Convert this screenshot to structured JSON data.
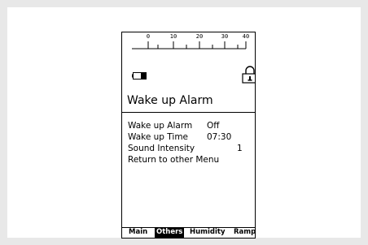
{
  "ruler": {
    "labels": [
      "0",
      "10",
      "20",
      "30",
      "40"
    ]
  },
  "status": {
    "battery_icon": "battery-low-icon",
    "lock_icon": "lock-icon"
  },
  "screen": {
    "title": "Wake up Alarm"
  },
  "menu": {
    "items": [
      {
        "label": "Wake up Alarm",
        "value": "Off"
      },
      {
        "label": "Wake up Time",
        "value": "07:30"
      },
      {
        "label": "Sound Intensity",
        "value": "1"
      },
      {
        "label": "Return to other Menu",
        "value": ""
      }
    ]
  },
  "tabs": {
    "items": [
      "Main",
      "Others",
      "Humidity",
      "Ramp"
    ],
    "active": "Others"
  },
  "colors": {
    "background": "#e8e8e8",
    "panel": "#ffffff",
    "ink": "#000000"
  }
}
